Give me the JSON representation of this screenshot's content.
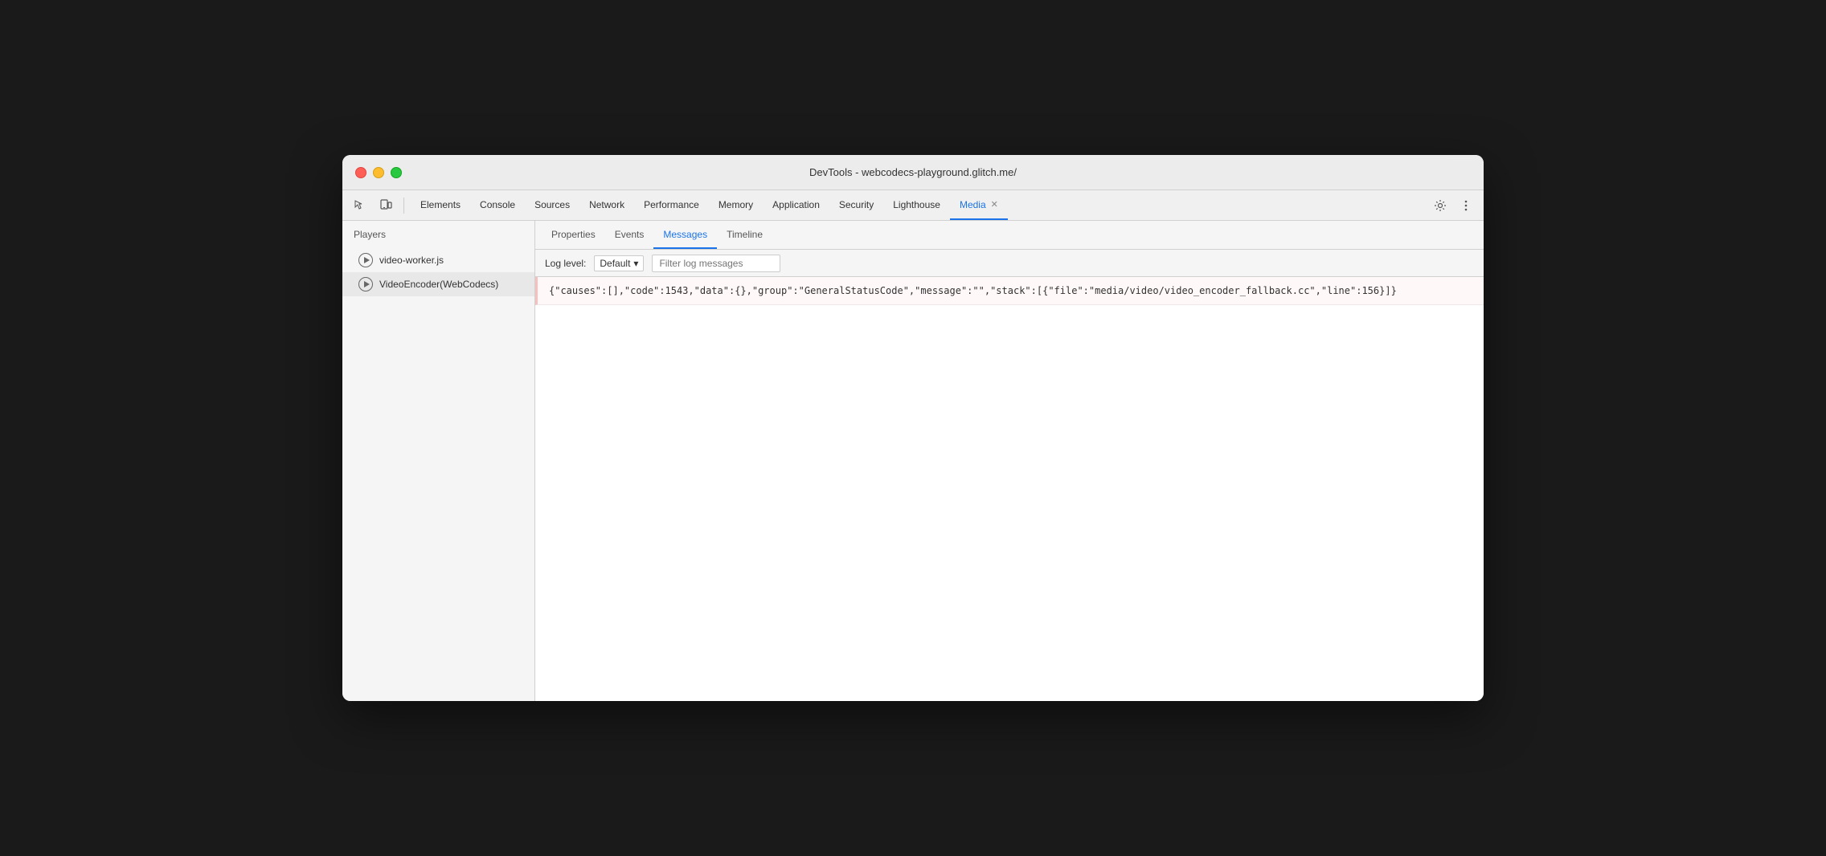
{
  "window": {
    "title": "DevTools - webcodecs-playground.glitch.me/"
  },
  "toolbar": {
    "inspect_label": "Inspect",
    "device_label": "Device",
    "tabs": [
      {
        "id": "elements",
        "label": "Elements",
        "active": false
      },
      {
        "id": "console",
        "label": "Console",
        "active": false
      },
      {
        "id": "sources",
        "label": "Sources",
        "active": false
      },
      {
        "id": "network",
        "label": "Network",
        "active": false
      },
      {
        "id": "performance",
        "label": "Performance",
        "active": false
      },
      {
        "id": "memory",
        "label": "Memory",
        "active": false
      },
      {
        "id": "application",
        "label": "Application",
        "active": false
      },
      {
        "id": "security",
        "label": "Security",
        "active": false
      },
      {
        "id": "lighthouse",
        "label": "Lighthouse",
        "active": false
      },
      {
        "id": "media",
        "label": "Media",
        "active": true,
        "closeable": true
      }
    ],
    "settings_title": "Settings",
    "more_title": "More"
  },
  "sidebar": {
    "header": "Players",
    "items": [
      {
        "id": "video-worker",
        "label": "video-worker.js",
        "selected": false
      },
      {
        "id": "video-encoder",
        "label": "VideoEncoder(WebCodecs)",
        "selected": true
      }
    ]
  },
  "panel": {
    "tabs": [
      {
        "id": "properties",
        "label": "Properties",
        "active": false
      },
      {
        "id": "events",
        "label": "Events",
        "active": false
      },
      {
        "id": "messages",
        "label": "Messages",
        "active": true
      },
      {
        "id": "timeline",
        "label": "Timeline",
        "active": false
      }
    ],
    "log_controls": {
      "label": "Log level:",
      "level": "Default",
      "filter_placeholder": "Filter log messages"
    },
    "log_entries": [
      {
        "id": "entry-1",
        "type": "error",
        "text": "{\"causes\":[],\"code\":1543,\"data\":{},\"group\":\"GeneralStatusCode\",\"message\":\"\",\"stack\":[{\"file\":\"media/video/video_encoder_fallback.cc\",\"line\":156}]}"
      }
    ]
  }
}
